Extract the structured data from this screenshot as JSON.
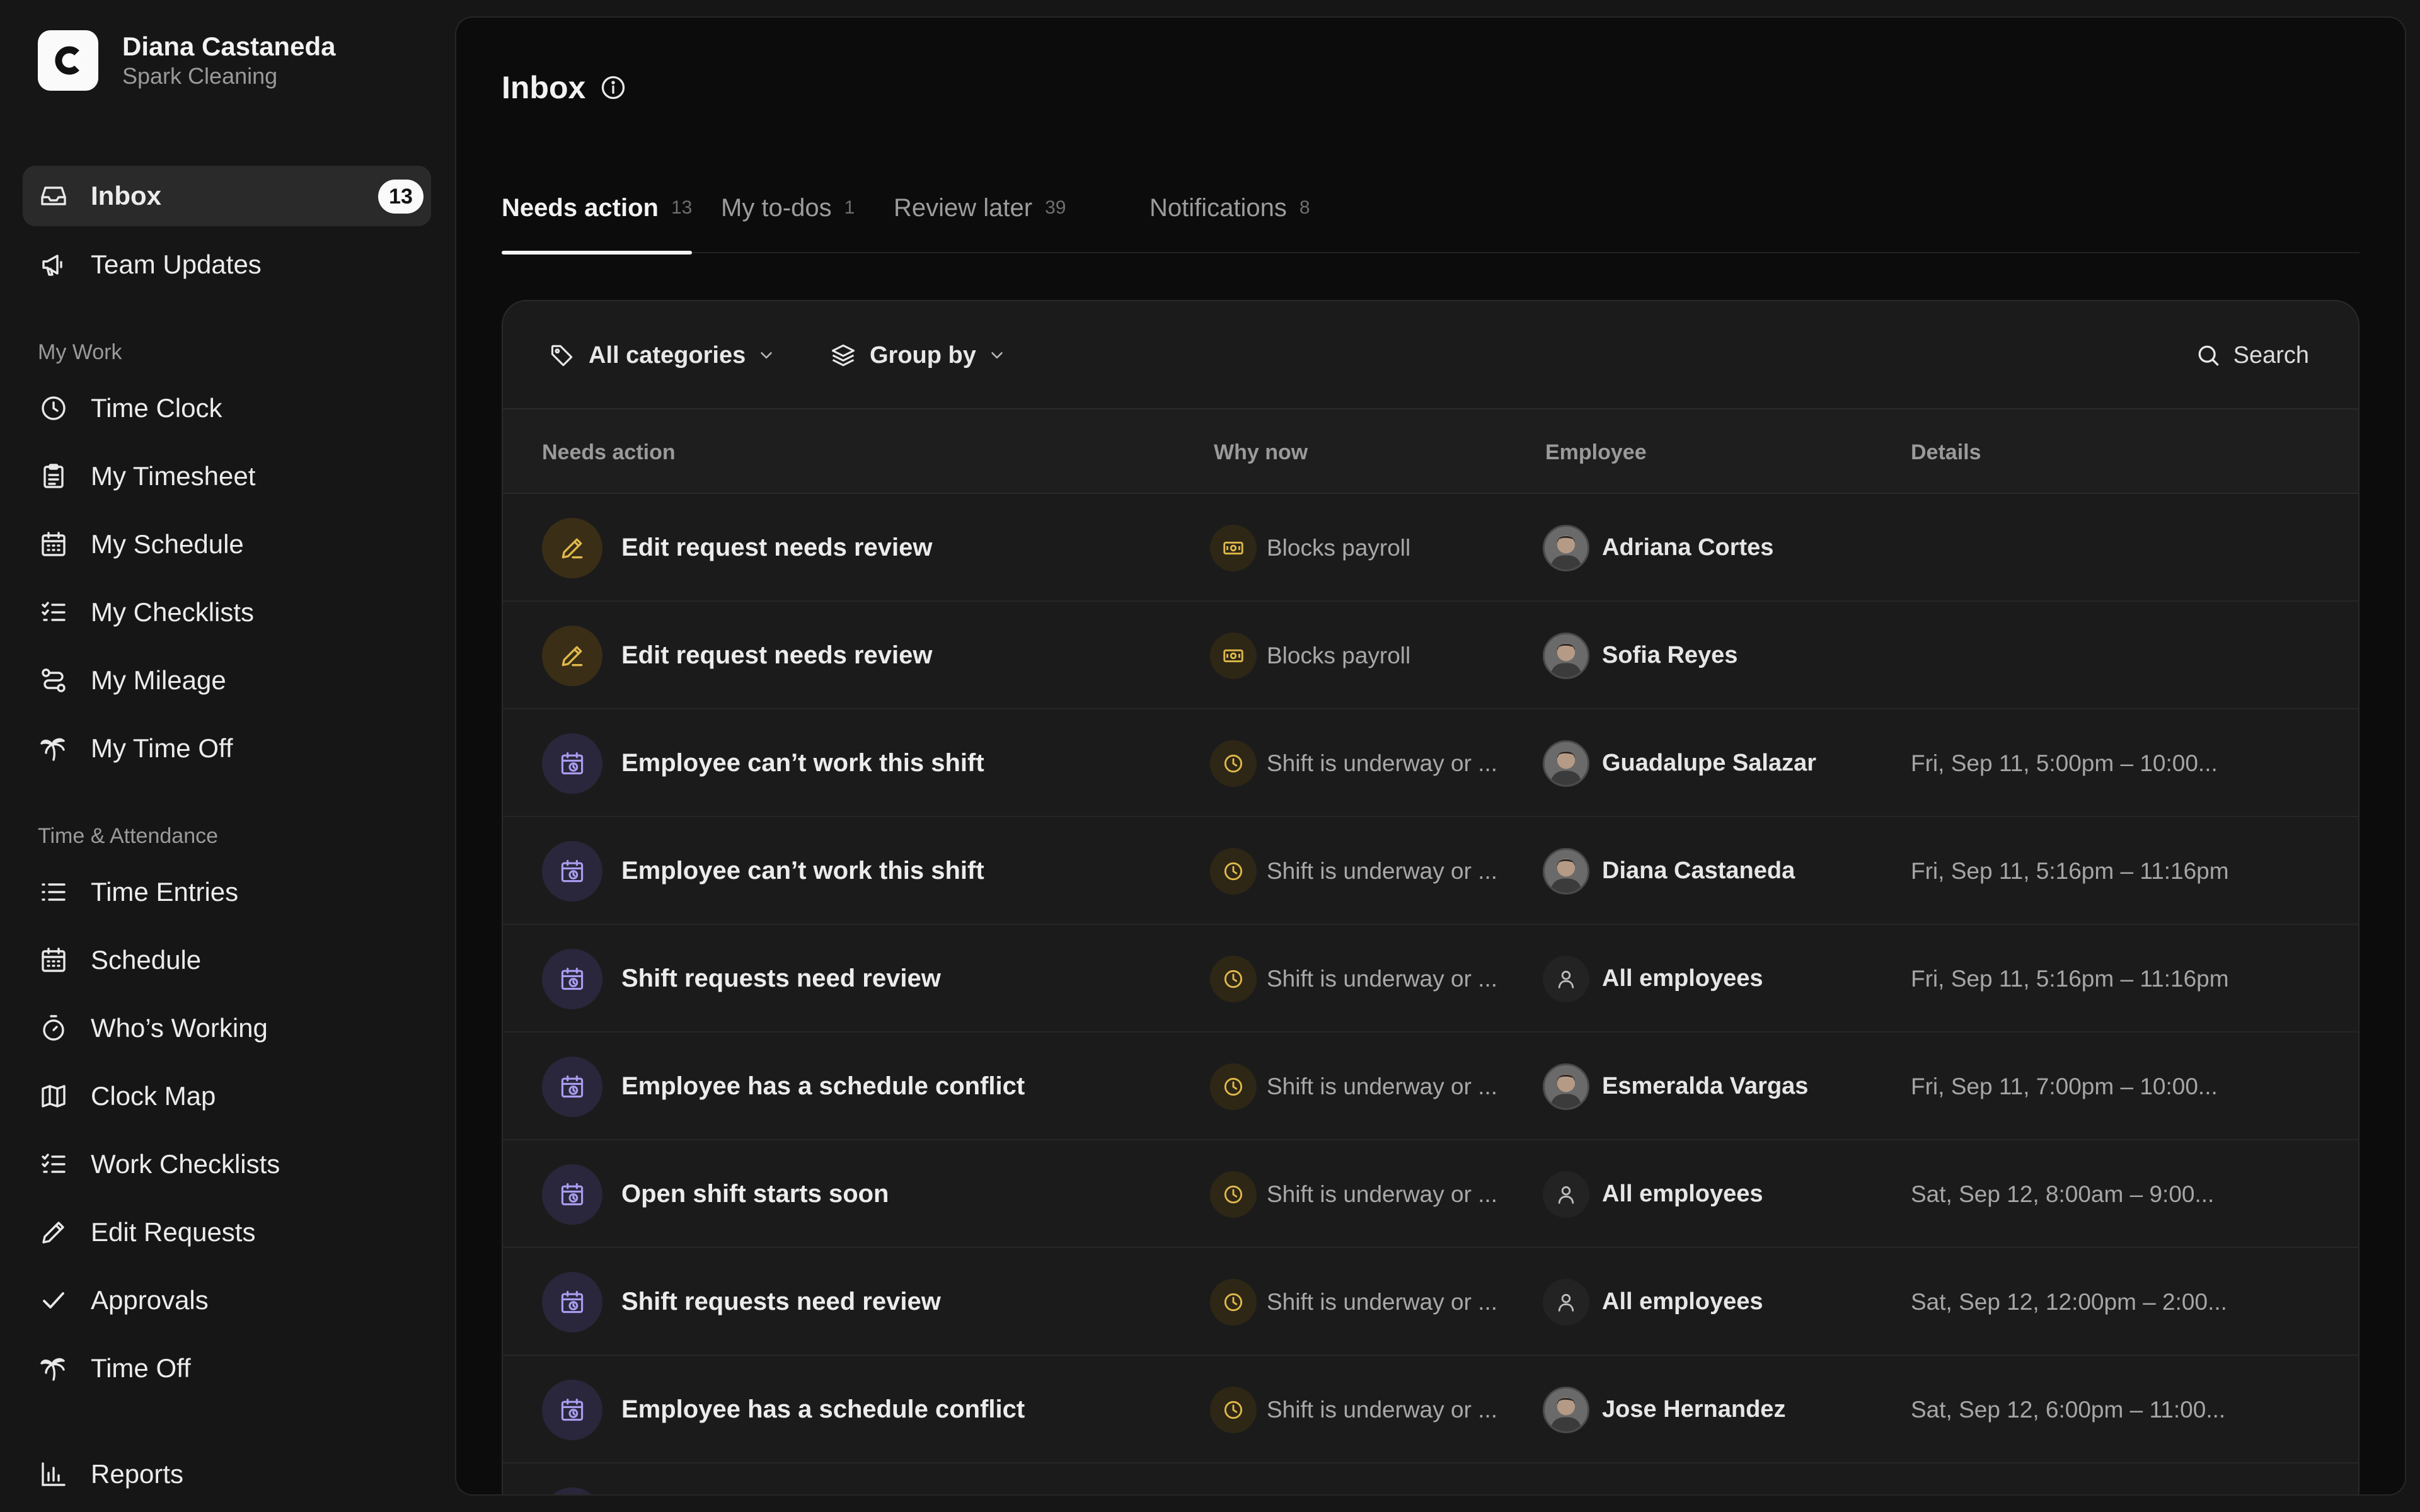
{
  "account": {
    "name": "Diana Castaneda",
    "company": "Spark Cleaning",
    "logo_letter": "C"
  },
  "sidebar": {
    "top": [
      {
        "label": "Inbox",
        "icon": "inbox-icon",
        "badge": "13",
        "active": true
      },
      {
        "label": "Team Updates",
        "icon": "megaphone-icon"
      }
    ],
    "my_work_label": "My Work",
    "my_work": [
      {
        "label": "Time Clock",
        "icon": "clock-icon"
      },
      {
        "label": "My Timesheet",
        "icon": "clipboard-icon"
      },
      {
        "label": "My Schedule",
        "icon": "calendar-icon"
      },
      {
        "label": "My Checklists",
        "icon": "checklist-icon"
      },
      {
        "label": "My Mileage",
        "icon": "route-icon"
      },
      {
        "label": "My Time Off",
        "icon": "palm-tree-icon"
      }
    ],
    "time_attendance_label": "Time & Attendance",
    "time_attendance": [
      {
        "label": "Time Entries",
        "icon": "list-icon"
      },
      {
        "label": "Schedule",
        "icon": "calendar-icon"
      },
      {
        "label": "Who’s Working",
        "icon": "stopwatch-icon"
      },
      {
        "label": "Clock Map",
        "icon": "map-icon"
      },
      {
        "label": "Work Checklists",
        "icon": "checklist-icon"
      },
      {
        "label": "Edit Requests",
        "icon": "pencil-icon"
      },
      {
        "label": "Approvals",
        "icon": "check-icon"
      },
      {
        "label": "Time Off",
        "icon": "palm-tree-icon"
      }
    ],
    "reports": {
      "label": "Reports",
      "icon": "bar-chart-icon"
    }
  },
  "page": {
    "title": "Inbox"
  },
  "tabs": [
    {
      "label": "Needs action",
      "count": "13",
      "active": true
    },
    {
      "label": "My to-dos",
      "count": "1"
    },
    {
      "label": "Review later",
      "count": "39"
    },
    {
      "label": "Notifications",
      "count": "8"
    }
  ],
  "toolbar": {
    "categories": "All categories",
    "group_by": "Group by",
    "search": "Search"
  },
  "table": {
    "headers": {
      "action": "Needs action",
      "why": "Why now",
      "employee": "Employee",
      "details": "Details"
    },
    "rows": [
      {
        "type": "edit",
        "title": "Edit request needs review",
        "why_icon": "payroll-icon",
        "why": "Blocks payroll",
        "employee": "Adriana Cortes",
        "avatar": "person",
        "details": ""
      },
      {
        "type": "edit",
        "title": "Edit request needs review",
        "why_icon": "payroll-icon",
        "why": "Blocks payroll",
        "employee": "Sofia Reyes",
        "avatar": "person",
        "details": ""
      },
      {
        "type": "shift",
        "title": "Employee can’t work this shift",
        "why_icon": "clock-icon",
        "why": "Shift is underway or ...",
        "employee": "Guadalupe Salazar",
        "avatar": "person",
        "details": "Fri, Sep 11, 5:00pm – 10:00..."
      },
      {
        "type": "shift",
        "title": "Employee can’t work this shift",
        "why_icon": "clock-icon",
        "why": "Shift is underway or ...",
        "employee": "Diana Castaneda",
        "avatar": "person",
        "details": "Fri, Sep 11, 5:16pm – 11:16pm"
      },
      {
        "type": "shift",
        "title": "Shift requests need review",
        "why_icon": "clock-icon",
        "why": "Shift is underway or ...",
        "employee": "All employees",
        "avatar": "group",
        "details": "Fri, Sep 11, 5:16pm – 11:16pm"
      },
      {
        "type": "shift",
        "title": "Employee has a schedule conflict",
        "why_icon": "clock-icon",
        "why": "Shift is underway or ...",
        "employee": "Esmeralda Vargas",
        "avatar": "person",
        "details": "Fri, Sep 11, 7:00pm – 10:00..."
      },
      {
        "type": "shift",
        "title": "Open shift starts soon",
        "why_icon": "clock-icon",
        "why": "Shift is underway or ...",
        "employee": "All employees",
        "avatar": "group",
        "details": "Sat, Sep 12, 8:00am – 9:00..."
      },
      {
        "type": "shift",
        "title": "Shift requests need review",
        "why_icon": "clock-icon",
        "why": "Shift is underway or ...",
        "employee": "All employees",
        "avatar": "group",
        "details": "Sat, Sep 12, 12:00pm – 2:00..."
      },
      {
        "type": "shift",
        "title": "Employee has a schedule conflict",
        "why_icon": "clock-icon",
        "why": "Shift is underway or ...",
        "employee": "Jose Hernandez",
        "avatar": "person",
        "details": "Sat, Sep 12, 6:00pm – 11:00..."
      },
      {
        "type": "shift",
        "title": "",
        "why_icon": "clock-icon",
        "why": "",
        "employee": "",
        "avatar": "person",
        "details": ""
      }
    ]
  },
  "colors": {
    "background": "#161616",
    "panel": "#0c0c0c",
    "card": "#1b1b1b",
    "accent_amber": "#e0b94a",
    "accent_violet": "#a99df0",
    "text": "#ececec",
    "muted": "#9a9a9a"
  }
}
